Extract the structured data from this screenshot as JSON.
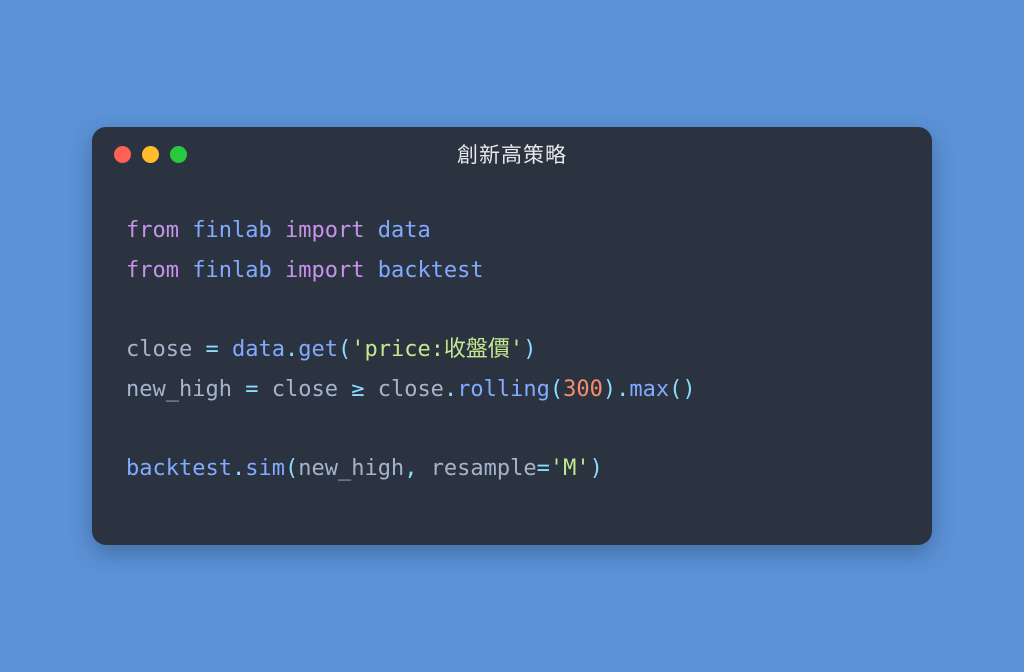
{
  "window": {
    "title": "創新高策略"
  },
  "code": {
    "l1": {
      "kw1": "from",
      "id1": "finlab",
      "kw2": "import",
      "id2": "data"
    },
    "l2": {
      "kw1": "from",
      "id1": "finlab",
      "kw2": "import",
      "id2": "backtest"
    },
    "l3": "",
    "l4": {
      "var1": "close",
      "op1": "=",
      "id1": "data",
      "dot1": ".",
      "fn1": "get",
      "p1": "(",
      "str1": "'price:收盤價'",
      "p2": ")"
    },
    "l5": {
      "var1": "new_high",
      "op1": "=",
      "var2": "close",
      "op2": "≥",
      "var3": "close",
      "dot1": ".",
      "fn1": "rolling",
      "p1": "(",
      "num1": "300",
      "p2": ")",
      "dot2": ".",
      "fn2": "max",
      "p3": "(",
      "p4": ")"
    },
    "l6": "",
    "l7": {
      "id1": "backtest",
      "dot1": ".",
      "fn1": "sim",
      "p1": "(",
      "var1": "new_high",
      "c1": ",",
      "sp1": " ",
      "arg1": "resample",
      "op1": "=",
      "str1": "'M'",
      "p2": ")"
    }
  }
}
